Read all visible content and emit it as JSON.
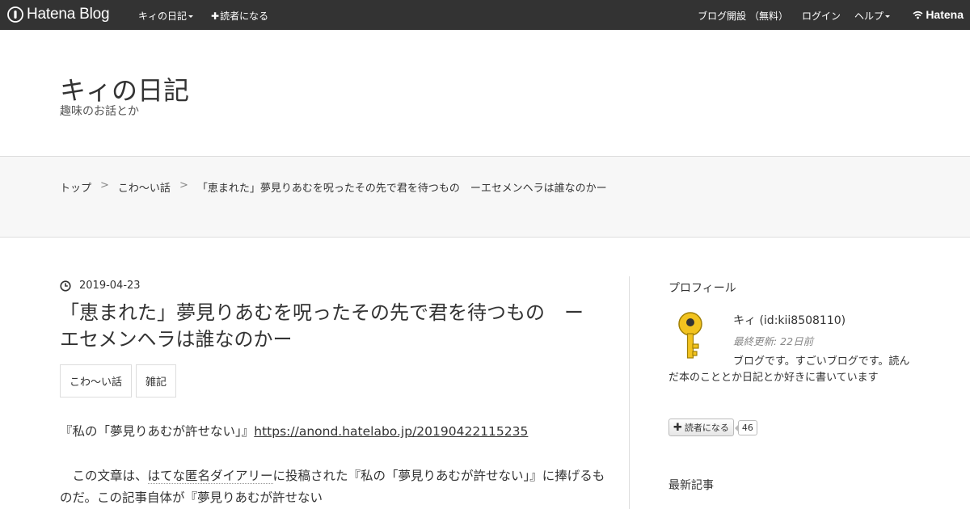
{
  "topbar": {
    "logo_text": "Hatena Blog",
    "blog_menu": "キィの日記",
    "subscribe": "読者になる",
    "open_blog": "ブログ開設 （無料）",
    "login": "ログイン",
    "help": "ヘルプ",
    "hatena": "Hatena"
  },
  "header": {
    "title": "キィの日記",
    "description": "趣味のお話とか"
  },
  "breadcrumb": [
    "トップ",
    "こわ～い話",
    "「恵まれた」夢見りあむを呪ったその先で君を待つもの　ーエセメンヘラは誰なのかー"
  ],
  "breadcrumb_sep": ">",
  "entry": {
    "date": "2019-04-23",
    "title": "「恵まれた」夢見りあむを呪ったその先で君を待つもの　ーエセメンヘラは誰なのかー",
    "categories": [
      "こわ～い話",
      "雑記"
    ],
    "p1_prefix": "『私の「夢見りあむが許せない」』",
    "p1_link": "https://anond.hatelabo.jp/20190422115235",
    "p2_indent": "　この文章は、",
    "p2_keyword": "はてな匿名ダイアリー",
    "p2_rest": "に投稿された『私の「夢見りあむが許せない」』に捧げるものだ。この記事自体が『夢見りあむが許せない"
  },
  "sidebar": {
    "profile_heading": "プロフィール",
    "author": "キィ (id:kii8508110)",
    "updated": "最終更新: 22日前",
    "bio": "ブログです。すごいブログです。読んだ本のこととか日記とか好きに書いています",
    "subscribe_label": "読者になる",
    "subscriber_count": "46",
    "recent_heading": "最新記事"
  },
  "colors": {
    "topbar_bg": "#333333",
    "band_bg": "#f7f7f7",
    "key_yellow": "#f2c31f"
  }
}
